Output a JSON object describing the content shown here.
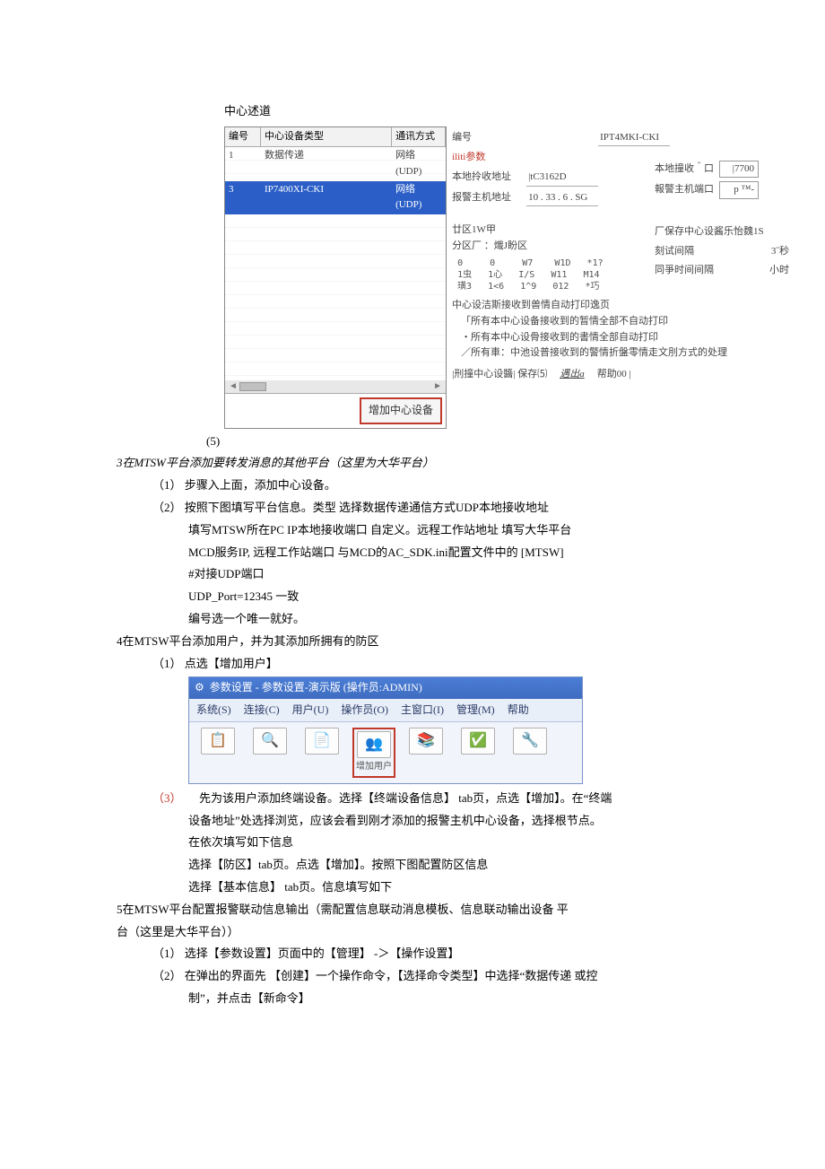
{
  "sectionTitle": "中心述道",
  "listPanel": {
    "headers": {
      "a": "编号",
      "b": "中心设备类型",
      "c": "通讯方式"
    },
    "row1": {
      "a": "1",
      "b": "数据传递",
      "c": "网络 (UDP)"
    },
    "row2": {
      "a": "3",
      "b": "IP7400XI-CKI",
      "c": "网络 (UDP)"
    },
    "scrollL": "◄",
    "scrollR": "►",
    "addBtn": "增加中心设备"
  },
  "rightPanel": {
    "labelNo": "编号",
    "valNo": "IPT4MKI-CKI",
    "paramTitle": "iliti参数",
    "labelLocalAddr": "本地拎收地址",
    "valLocalAddr": "|tC3162D",
    "labelAlarmAddr": "报警主机地址",
    "valAlarmAddr": "10 . 33 . 6 . SG",
    "labelLocalPort": "本地撞收＾口",
    "valLocalPort": "|7700",
    "labelAlarmPort": "報警主机端口",
    "valAlarmPort": "p ™-",
    "zoneHead": "廿区1W甲",
    "zoneSub": "分区厂 ：熾J盼区",
    "gridLine1": "0     0     W7    W1D   *1?",
    "gridLine2": "1虫   1心   I/S   W11   M14",
    "gridLine3": "璜3   1<6   1^9   012   *巧",
    "saveLine": "厂保存中心设酱乐怡魏1S",
    "labelTestInt": "刻试间隔",
    "valTestInt": "3˝秒",
    "labelSyncInt": "同爭时间间隔",
    "valSyncInt": "小时",
    "printTitle": "中心设洁斯接收到兽情自动打印逸页",
    "printOpt1": "「所有本中心设备接收到的暂情全部不自动打印",
    "printOpt2": "・所有本中心设骨接收到的書情全部自动打印",
    "printOpt3": "／所有車：中池设普接收到的警情折盤零情走文刖方式的处理",
    "footDel": "|刑撞中心设醬| 保存⑸",
    "footExit": "遇出a",
    "footHelp": "帮助00   |"
  },
  "caption5": "(5)",
  "step3title": "3在MTSW平台添加要转发消息的其他平台（这里为大华平台）",
  "s3_1": "（1） 步骤入上面，添加中心设备。",
  "s3_2a": "（2） 按照下图填写平台信息。类型    选择数据传递通信方式UDP本地接收地址",
  "s3_2b": "填写MTSW所在PC IP本地接收端口 自定义。远程工作站地址        填写大华平台",
  "s3_2c": "MCD服务IP, 远程工作站端口 与MCD的AC_SDK.ini配置文件中的 [MTSW]",
  "s3_2d": "#对接UDP端口",
  "s3_2e": "UDP_Port=12345 一致",
  "s3_2f": "编号选一个唯一就好。",
  "step4title": "4在MTSW平台添加用户，并为其添加所拥有的防区",
  "s4_1": "（1） 点选【增加用户】",
  "fig2": {
    "title": "参数设置 - 参数设置-演示版   (操作员:ADMIN)",
    "menu": [
      "系统(S)",
      "连接(C)",
      "用户(U)",
      "操作员(O)",
      "主窗口(I)",
      "管理(M)",
      "帮助"
    ],
    "icons": [
      "📋",
      "🔍",
      "📄",
      "👥",
      "📚",
      "✅",
      "🔧"
    ],
    "addUserLabel": "增加用户"
  },
  "s4_3num": "（3）",
  "s4_3a": "先为该用户添加终端设备。选择【终端设备信息】    tab页，点选【增加】。在“终端",
  "s4_3b": "设备地址”处选择浏览，应该会看到刚才添加的报警主机中心设备，选择根节点。",
  "s4_3c": "在依次填写如下信息",
  "s4_3d": "选择【防区】tab页。点选【增加】。按照下图配置防区信息",
  "s4_3e": "选择【基本信息】   tab页。信息填写如下",
  "step5a": "5在MTSW平台配置报警联动信息输出（需配置信息联动消息模板、信息联动输出设备          平",
  "step5b": "台（这里是大华平台））",
  "s5_1": "（1） 选择【参数设置】页面中的【管理】   -＞【操作设置】",
  "s5_2a": "（2） 在弹出的界面先    【创建】一个操作命令，【选择命令类型】中选择“数据传递 或控",
  "s5_2b": "制”，并点击【新命令】"
}
